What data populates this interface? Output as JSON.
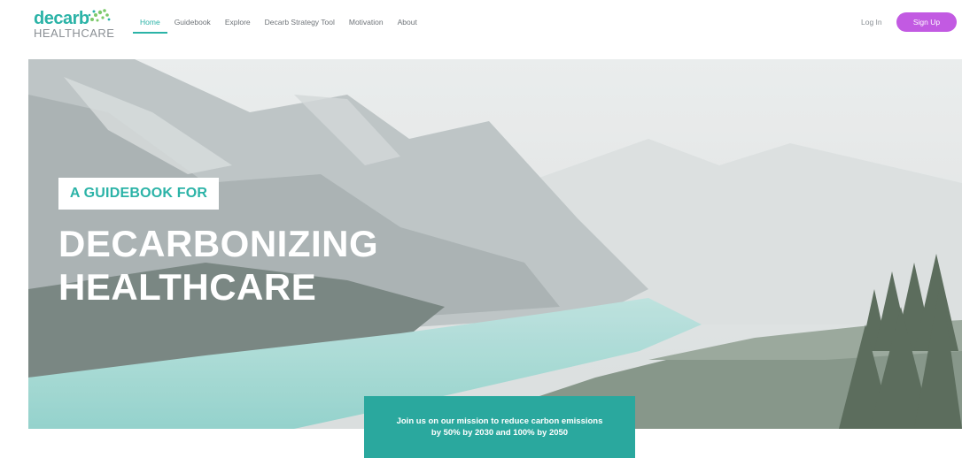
{
  "brand": {
    "name_primary": "decarb",
    "name_secondary": "HEALTHCARE",
    "icon": "leaf-sprig-icon",
    "accent_color": "#2bb3a7",
    "signup_color": "#c25ae2"
  },
  "nav": {
    "items": [
      {
        "label": "Home",
        "active": true
      },
      {
        "label": "Guidebook"
      },
      {
        "label": "Explore"
      },
      {
        "label": "Decarb Strategy Tool"
      },
      {
        "label": "Motivation"
      },
      {
        "label": "About"
      }
    ],
    "login_label": "Log In",
    "signup_label": "Sign Up"
  },
  "hero": {
    "tag": "A GUIDEBOOK FOR",
    "title_line1": "DECARBONIZING",
    "title_line2": "HEALTHCARE"
  },
  "mission": {
    "line1": "Join us on our mission to reduce carbon emissions",
    "line2": "by 50% by 2030 and 100% by 2050"
  }
}
